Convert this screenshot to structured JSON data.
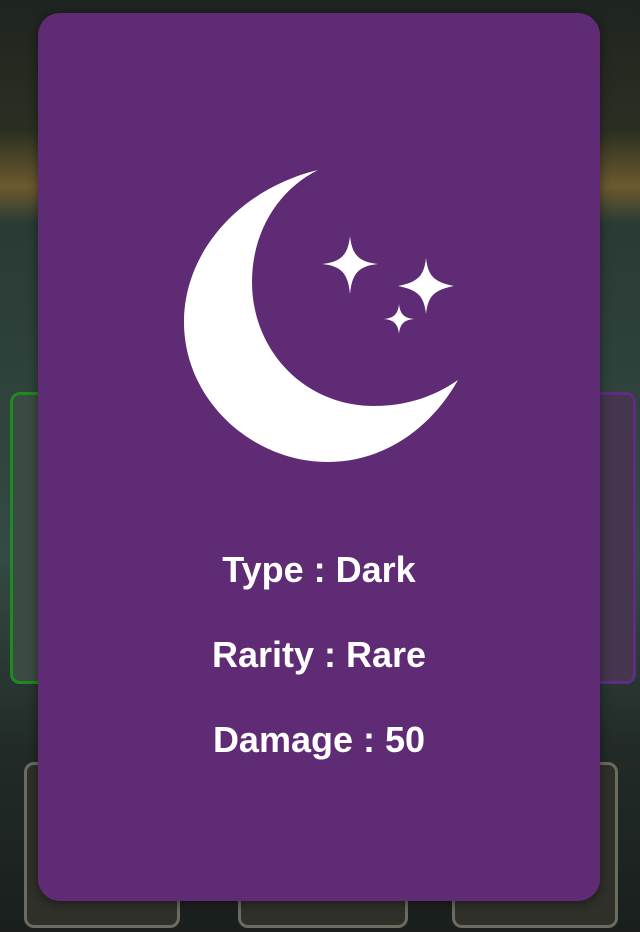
{
  "card": {
    "icon": "crescent-moon-stars-icon",
    "background_color": "#602b75",
    "type_line": "Type : Dark",
    "rarity_line": "Rarity : Rare",
    "damage_line": "Damage : 50"
  }
}
